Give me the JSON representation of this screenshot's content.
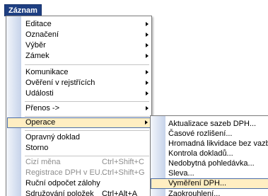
{
  "menubar": {
    "title": "Záznam"
  },
  "menu": {
    "items": [
      {
        "label": "Editace",
        "has_submenu": true
      },
      {
        "label": "Označení",
        "has_submenu": true
      },
      {
        "label": "Výběr",
        "has_submenu": true
      },
      {
        "label": "Zámek",
        "has_submenu": true
      },
      {
        "label": "Komunikace",
        "has_submenu": true
      },
      {
        "label": "Ověření v rejstřících",
        "has_submenu": true
      },
      {
        "label": "Události",
        "has_submenu": true
      },
      {
        "label": "Přenos ->",
        "has_submenu": true
      },
      {
        "label": "Operace",
        "has_submenu": true,
        "highlighted": true
      },
      {
        "label": "Opravný doklad"
      },
      {
        "label": "Storno"
      },
      {
        "label": "Cizí měna",
        "shortcut": "Ctrl+Shift+C",
        "disabled": true
      },
      {
        "label": "Registrace DPH v EU...",
        "shortcut": "Ctrl+Shift+G",
        "disabled": true
      },
      {
        "label": "Ruční odpočet zálohy"
      },
      {
        "label": "Sdružování položek",
        "shortcut": "Ctrl+Alt+A"
      }
    ]
  },
  "submenu": {
    "items": [
      {
        "label": "Aktualizace sazeb DPH..."
      },
      {
        "label": "Časové rozlišení..."
      },
      {
        "label": "Hromadná likvidace bez vazby..."
      },
      {
        "label": "Kontrola dokladů..."
      },
      {
        "label": "Nedobytná pohledávka..."
      },
      {
        "label": "Sleva..."
      },
      {
        "label": "Vyměření DPH...",
        "highlighted": true
      },
      {
        "label": "Zaokrouhlení..."
      }
    ]
  }
}
